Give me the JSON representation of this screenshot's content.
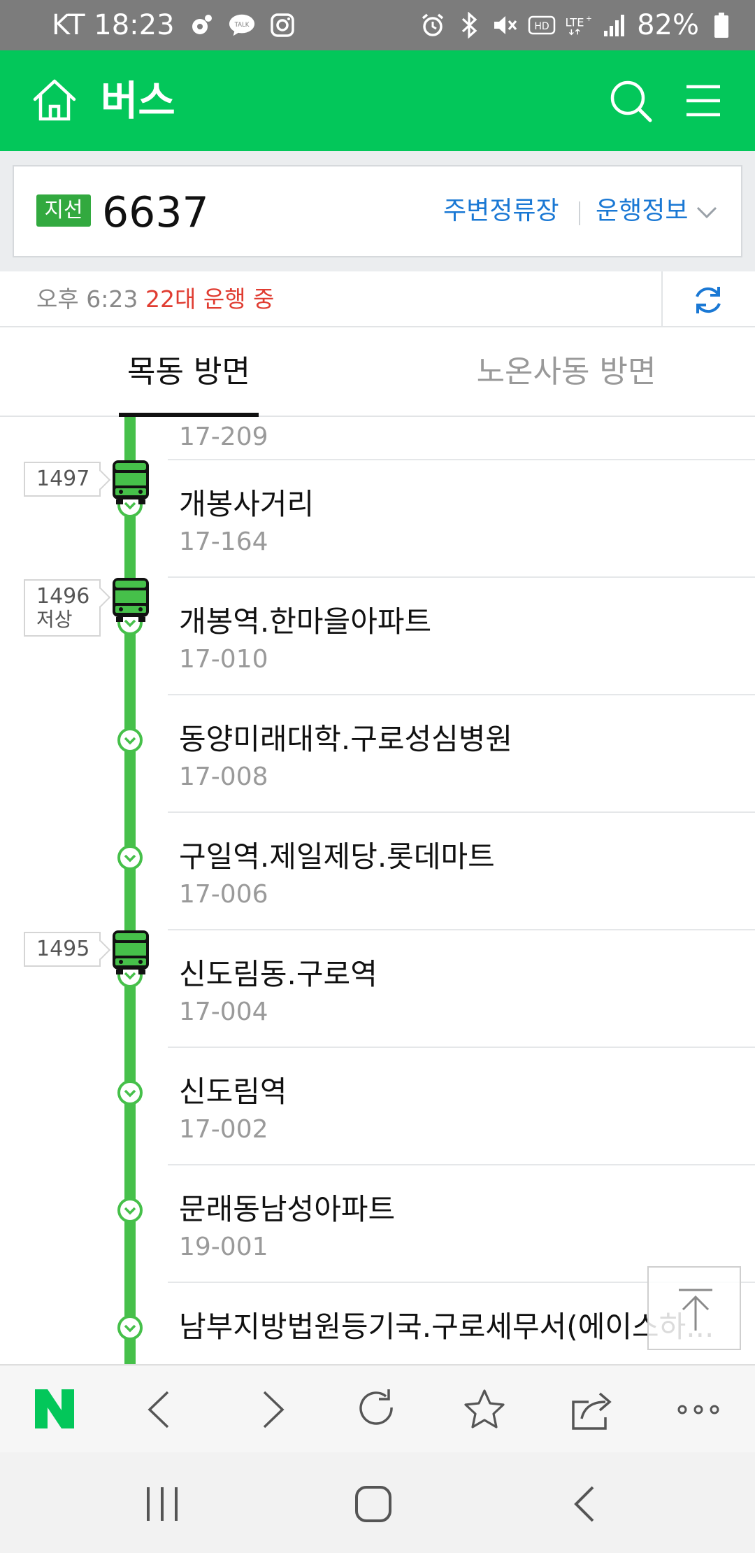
{
  "status_bar": {
    "carrier_time": "KT 18:23",
    "battery": "82%",
    "left_icons": [
      "notification-dot-icon",
      "kakaotalk-icon",
      "instagram-icon"
    ],
    "right_icons": [
      "alarm-icon",
      "bluetooth-icon",
      "mute-icon",
      "hd-icon",
      "lte-icon",
      "signal-icon",
      "battery-icon"
    ]
  },
  "header": {
    "title": "버스",
    "background": "#03c75a"
  },
  "route": {
    "type_badge": "지선",
    "number": "6637",
    "nearby_stops_label": "주변정류장",
    "info_label": "운행정보",
    "badge_color": "#32a93f"
  },
  "status": {
    "time": "오후 6:23",
    "running": "22대 운행 중"
  },
  "tabs": [
    {
      "label": "목동 방면",
      "selected": true
    },
    {
      "label": "노온사동 방면",
      "selected": false
    }
  ],
  "stops": [
    {
      "name": "",
      "code": "17-209"
    },
    {
      "name": "개봉사거리",
      "code": "17-164"
    },
    {
      "name": "개봉역.한마을아파트",
      "code": "17-010"
    },
    {
      "name": "동양미래대학.구로성심병원",
      "code": "17-008"
    },
    {
      "name": "구일역.제일제당.롯데마트",
      "code": "17-006"
    },
    {
      "name": "신도림동.구로역",
      "code": "17-004"
    },
    {
      "name": "신도림역",
      "code": "17-002"
    },
    {
      "name": "문래동남성아파트",
      "code": "19-001"
    },
    {
      "name": "남부지방법원등기국.구로세무서(에이스하...",
      "code": ""
    }
  ],
  "buses": [
    {
      "number": "1497",
      "note": ""
    },
    {
      "number": "1496",
      "note": "저상"
    },
    {
      "number": "1495",
      "note": ""
    }
  ],
  "browser_toolbar": [
    "naver-logo",
    "back-icon",
    "forward-icon",
    "reload-icon",
    "bookmark-star-icon",
    "share-icon",
    "more-icon"
  ],
  "system_nav": [
    "recent-apps-icon",
    "home-button-icon",
    "back-nav-icon"
  ]
}
